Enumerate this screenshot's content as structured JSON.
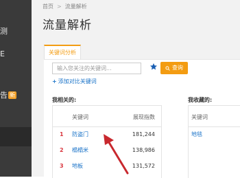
{
  "sidebar": {
    "fragments": [
      "测",
      "E",
      "告"
    ],
    "badge": "新"
  },
  "breadcrumb": {
    "home": "首页",
    "separator": ">",
    "current": "流量解析"
  },
  "page_title": "流量解析",
  "tab": {
    "label": "关键词分析"
  },
  "search": {
    "placeholder": "输入您关注的关键词...",
    "value": "",
    "query_label": "查询"
  },
  "add_compare_label": "添加对比关键词",
  "related": {
    "title": "我相关的:",
    "columns": [
      "关键词",
      "展现指数"
    ],
    "rows": [
      {
        "rank": "1",
        "keyword": "防盗门",
        "index": "181,244"
      },
      {
        "rank": "2",
        "keyword": "榻榻米",
        "index": "138,986"
      },
      {
        "rank": "3",
        "keyword": "地板",
        "index": "131,572"
      }
    ]
  },
  "favorites": {
    "title": "我收藏的:",
    "columns": [
      "关键词"
    ],
    "rows": [
      {
        "keyword": "地毯"
      }
    ]
  },
  "colors": {
    "accent": "#f39c12",
    "link": "#1a73c8",
    "rank": "#d9363e",
    "arrow": "#c8282e",
    "sidebar": "#3a3a3a"
  }
}
